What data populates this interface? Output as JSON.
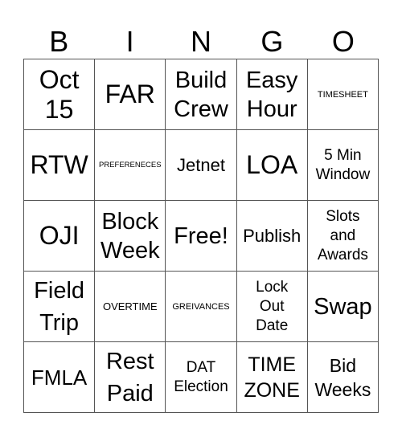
{
  "header": {
    "letters": [
      "B",
      "I",
      "N",
      "G",
      "O"
    ]
  },
  "cells": [
    [
      "Oct 15",
      "FAR",
      "Build Crew",
      "Easy Hour",
      "TIMESHEET"
    ],
    [
      "RTW",
      "PREFERENECES",
      "Jetnet",
      "LOA",
      "5 Min Window"
    ],
    [
      "OJI",
      "Block Week",
      "Free!",
      "Publish",
      "Slots and Awards"
    ],
    [
      "Field Trip",
      "OVERTIME",
      "GREIVANCES",
      "Lock Out Date",
      "Swap"
    ],
    [
      "FMLA",
      "Rest Paid",
      "DAT Election",
      "TIME ZONE",
      "Bid Weeks"
    ]
  ],
  "lines": {
    "c0": [
      "Oct",
      "15"
    ],
    "c2": [
      "Build",
      "Crew"
    ],
    "c3": [
      "Easy",
      "Hour"
    ],
    "c9": [
      "5 Min",
      "Window"
    ],
    "c11": [
      "Block",
      "Week"
    ],
    "c14": [
      "Slots",
      "and",
      "Awards"
    ],
    "c15": [
      "Field",
      "Trip"
    ],
    "c18": [
      "Lock",
      "Out",
      "Date"
    ],
    "c21": [
      "Rest",
      "Paid"
    ],
    "c22": [
      "DAT",
      "Election"
    ],
    "c23": [
      "TIME",
      "ZONE"
    ],
    "c24": [
      "Bid",
      "Weeks"
    ]
  }
}
